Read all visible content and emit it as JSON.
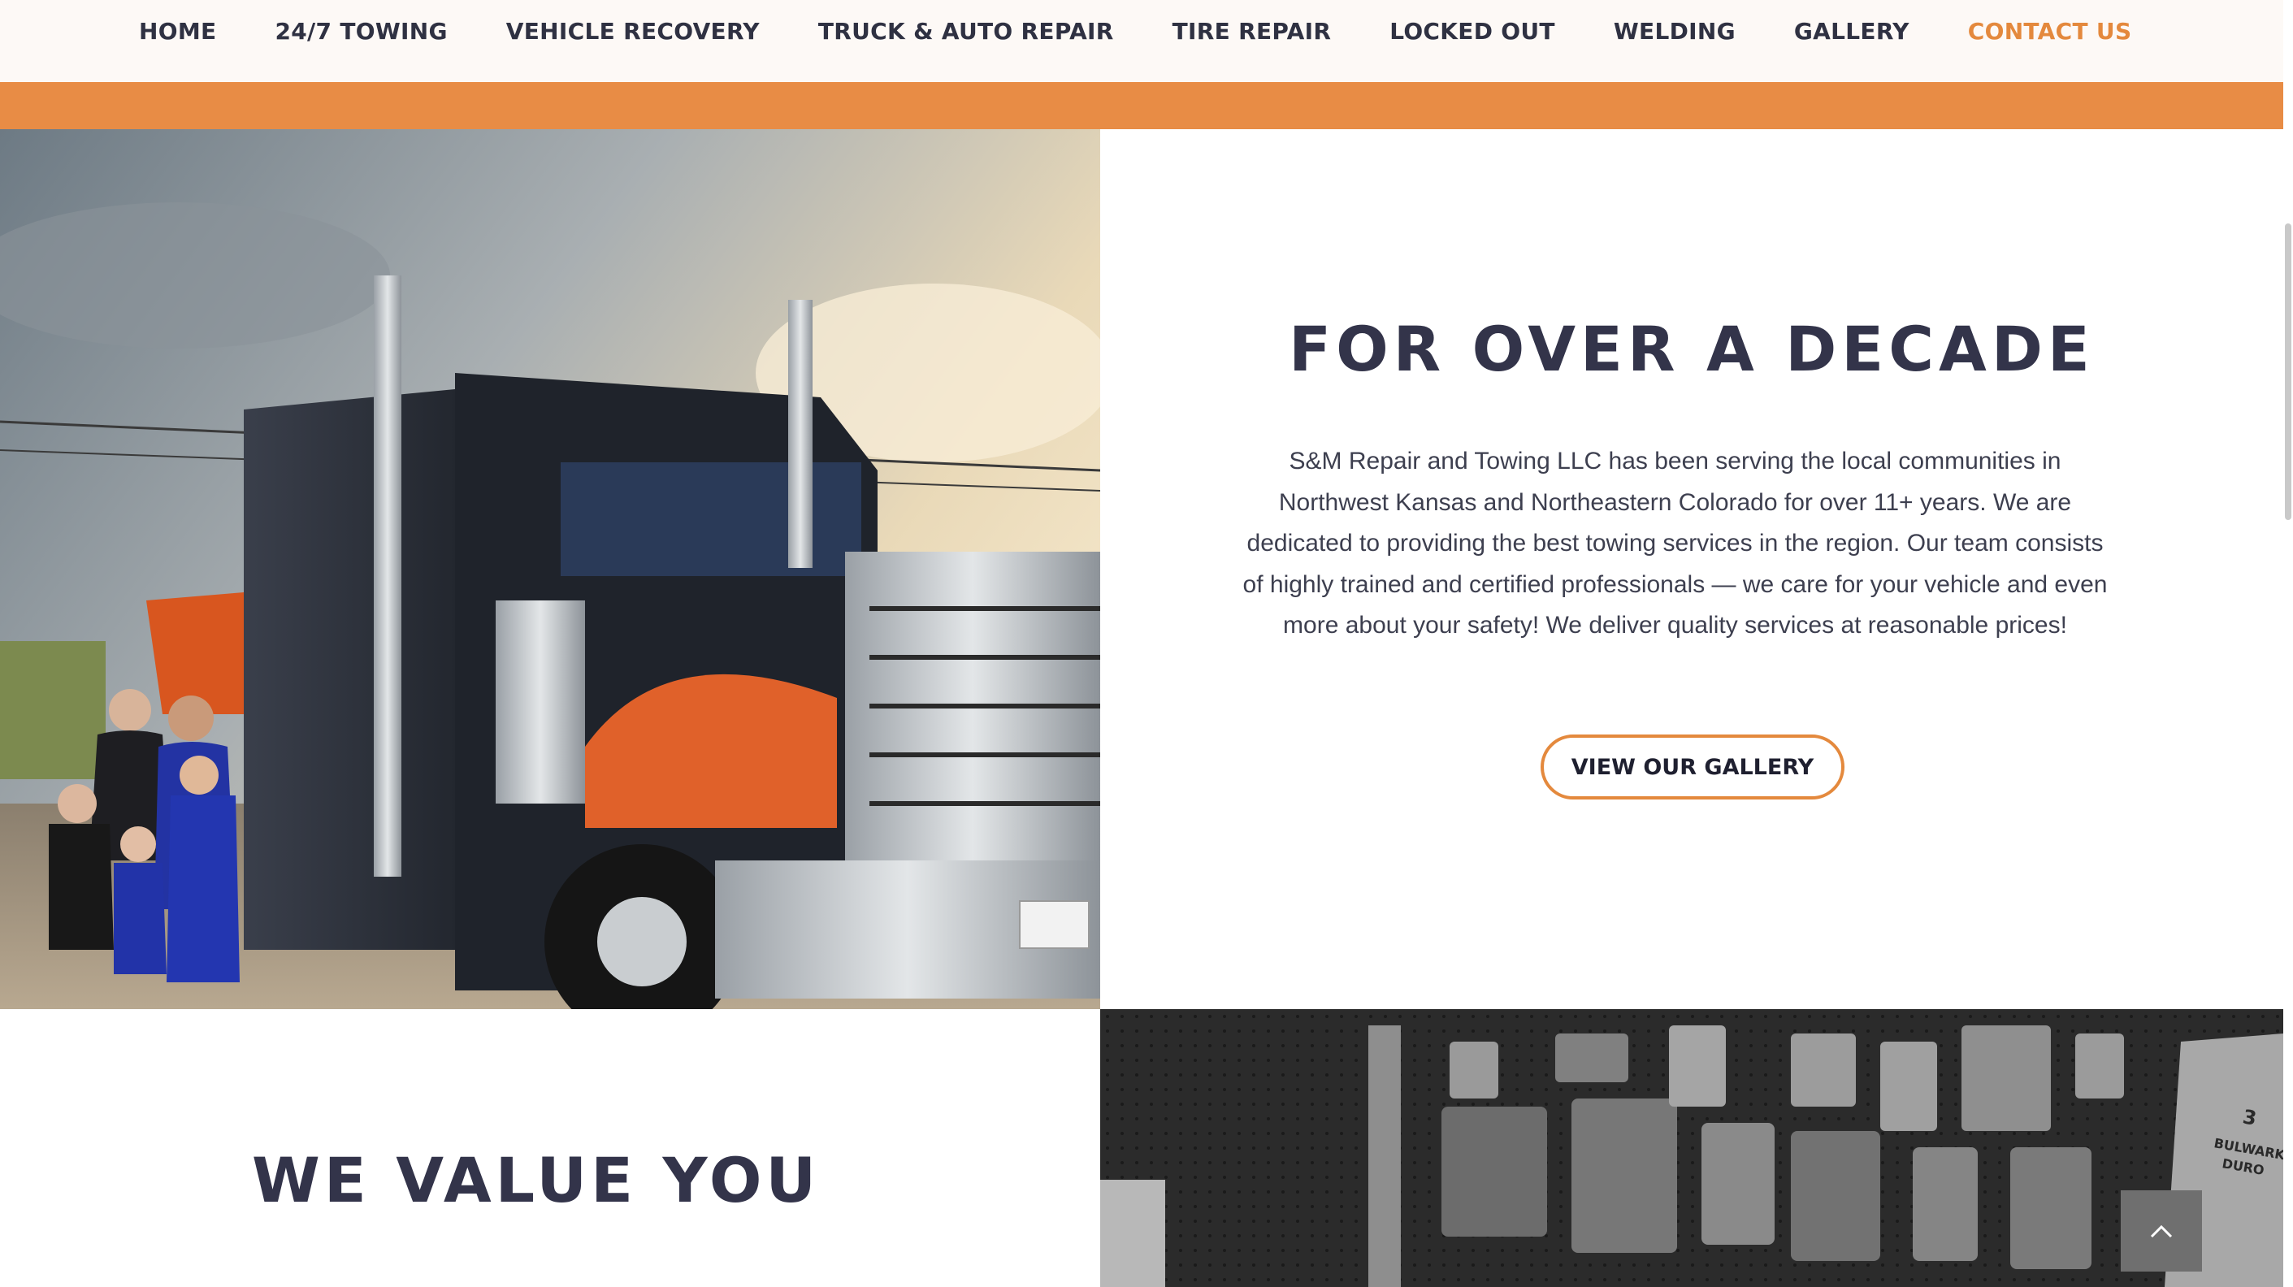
{
  "nav": {
    "items": [
      {
        "label": "HOME",
        "active": false
      },
      {
        "label": "24/7 TOWING",
        "active": false
      },
      {
        "label": "VEHICLE RECOVERY",
        "active": false
      },
      {
        "label": "TRUCK & AUTO REPAIR",
        "active": false
      },
      {
        "label": "TIRE REPAIR",
        "active": false
      },
      {
        "label": "LOCKED OUT",
        "active": false
      },
      {
        "label": "WELDING",
        "active": false
      },
      {
        "label": "GALLERY",
        "active": false
      },
      {
        "label": "CONTACT US",
        "active": true
      }
    ]
  },
  "hero": {
    "title": "FOR OVER A DECADE",
    "paragraph": "S&M Repair and Towing LLC has been serving the local communities in Northwest Kansas and Northeastern Colorado for over 11+ years. We are dedicated to providing the best towing services in the region. Our team consists of highly trained and certified professionals — we care for your vehicle and even more about your safety! We deliver quality services at reasonable prices!",
    "button_label": "VIEW OUR GALLERY",
    "image_alt": "Family standing next to orange and black tow truck"
  },
  "value": {
    "title": "WE VALUE YOU"
  },
  "parts_image": {
    "alt": "Black and white photo of auto parts on a pegboard wall",
    "brand_text": "3 BULWARK DURO"
  },
  "colors": {
    "accent": "#e88c45",
    "accent_text": "#e4893d",
    "heading": "#33344a",
    "nav_text": "#2f3142",
    "back_to_top_bg": "#6f6f6f"
  },
  "icons": {
    "back_to_top": "chevron-up-icon"
  }
}
